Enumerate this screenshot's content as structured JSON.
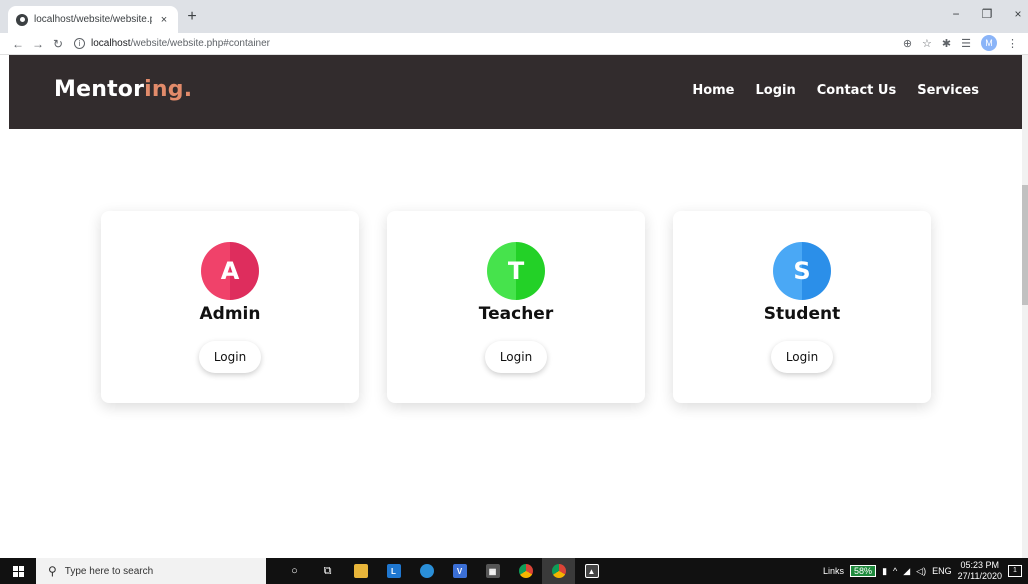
{
  "browser": {
    "tab_title": "localhost/website/website.php#c",
    "tab_close": "×",
    "new_tab": "+",
    "url_host": "localhost",
    "url_path": "/website/website.php#container",
    "profile_initial": "M",
    "window_controls": {
      "minimize": "−",
      "maximize": "❐",
      "close": "×"
    },
    "toolbar_icons": [
      "zoom-icon",
      "star-icon",
      "extensions-icon",
      "reading-list-icon",
      "profile-icon",
      "menu-icon"
    ]
  },
  "site": {
    "logo_main": "Mentor",
    "logo_accent": "ing.",
    "accent_color": "#e28b6a",
    "navbar_color": "#322c2d",
    "nav": [
      "Home",
      "Login",
      "Contact Us",
      "Services"
    ]
  },
  "cards": [
    {
      "initial": "A",
      "role": "Admin",
      "button": "Login",
      "color_light": "#f0426a",
      "color_dark": "#de2d5d"
    },
    {
      "initial": "T",
      "role": "Teacher",
      "button": "Login",
      "color_light": "#46e34c",
      "color_dark": "#23d127"
    },
    {
      "initial": "S",
      "role": "Student",
      "button": "Login",
      "color_light": "#4aa8f5",
      "color_dark": "#2b8fe9"
    }
  ],
  "taskbar": {
    "search_placeholder": "Type here to search",
    "tray": {
      "links_label": "Links",
      "battery": "58%",
      "language": "ENG",
      "time": "05:23 PM",
      "date": "27/11/2020",
      "notifications": "1"
    }
  }
}
